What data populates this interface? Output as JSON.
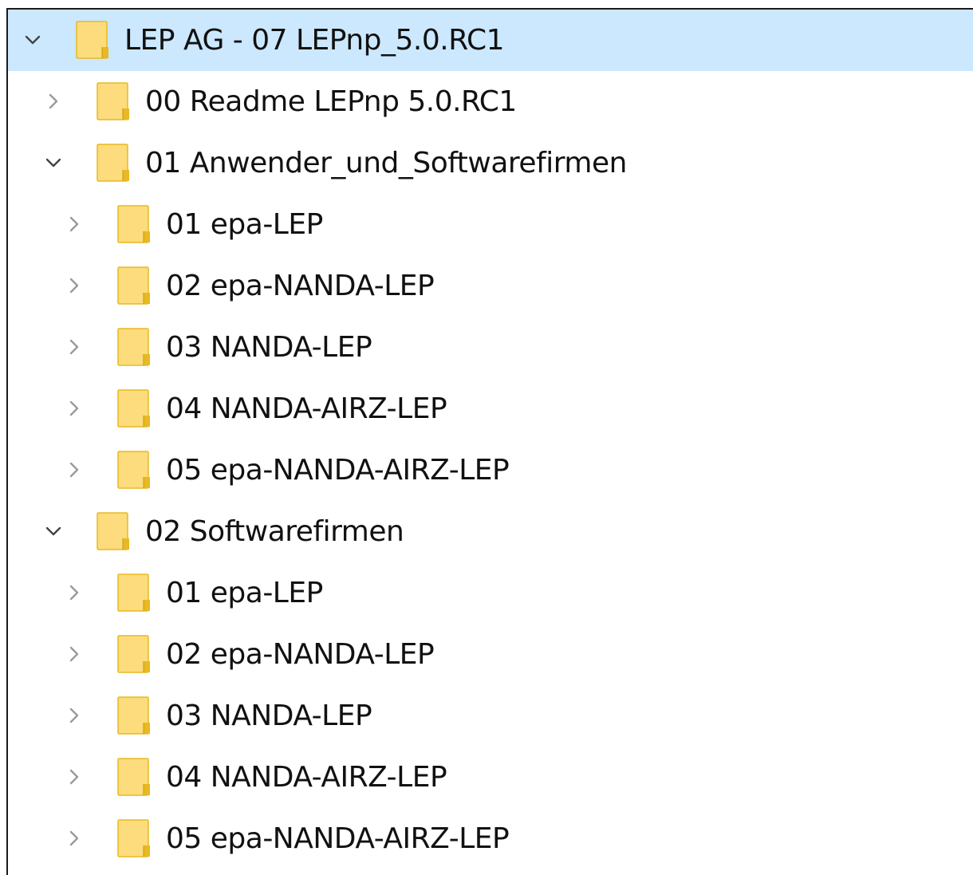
{
  "tree": {
    "items": [
      {
        "label": "LEP AG - 07 LEPnp_5.0.RC1",
        "level": 0,
        "expanded": true,
        "selected": true
      },
      {
        "label": "00 Readme LEPnp 5.0.RC1",
        "level": 1,
        "expanded": false,
        "selected": false
      },
      {
        "label": "01 Anwender_und_Softwarefirmen",
        "level": 1,
        "expanded": true,
        "selected": false
      },
      {
        "label": "01 epa-LEP",
        "level": 2,
        "expanded": false,
        "selected": false
      },
      {
        "label": "02 epa-NANDA-LEP",
        "level": 2,
        "expanded": false,
        "selected": false
      },
      {
        "label": "03 NANDA-LEP",
        "level": 2,
        "expanded": false,
        "selected": false
      },
      {
        "label": "04 NANDA-AIRZ-LEP",
        "level": 2,
        "expanded": false,
        "selected": false
      },
      {
        "label": "05 epa-NANDA-AIRZ-LEP",
        "level": 2,
        "expanded": false,
        "selected": false
      },
      {
        "label": "02 Softwarefirmen",
        "level": 1,
        "expanded": true,
        "selected": false
      },
      {
        "label": "01 epa-LEP",
        "level": 2,
        "expanded": false,
        "selected": false
      },
      {
        "label": "02 epa-NANDA-LEP",
        "level": 2,
        "expanded": false,
        "selected": false
      },
      {
        "label": "03 NANDA-LEP",
        "level": 2,
        "expanded": false,
        "selected": false
      },
      {
        "label": "04 NANDA-AIRZ-LEP",
        "level": 2,
        "expanded": false,
        "selected": false
      },
      {
        "label": "05 epa-NANDA-AIRZ-LEP",
        "level": 2,
        "expanded": false,
        "selected": false
      }
    ]
  },
  "icons": {
    "folder": "folder-icon",
    "expanded": "chevron-down-icon",
    "collapsed": "chevron-right-icon"
  },
  "colors": {
    "selection": "#cce8ff",
    "folder_fill": "#fcdc7c",
    "folder_shade": "#e8b923"
  }
}
